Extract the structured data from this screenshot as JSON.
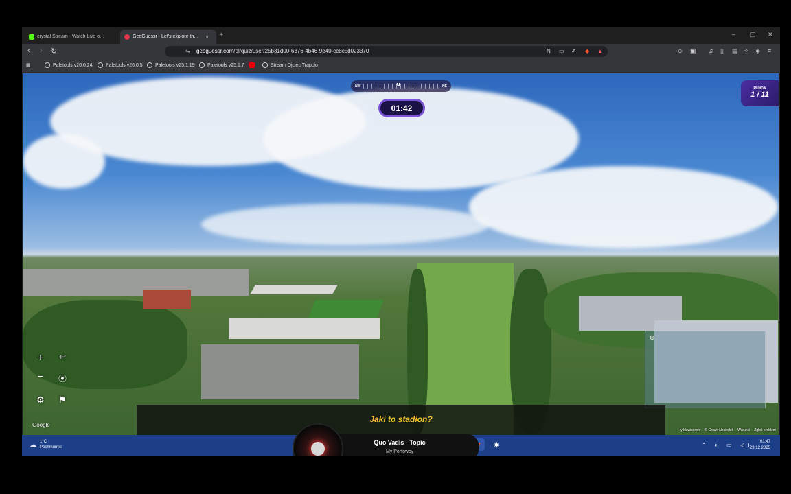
{
  "browser": {
    "tabs": [
      {
        "label": "crystal Stream - Watch Live on Ki",
        "active": false
      },
      {
        "label": "GeoGuessr - Let's explore the wo",
        "active": true
      }
    ],
    "url_host": "geoguessr.com",
    "url_path": "/pl/quiz/user/25b31d00-6376-4b46-9e40-cc8c5d023370",
    "bookmarks": [
      "Paletools v26.0.24",
      "Paletools v26.0.5",
      "Paletools v25.1.19",
      "Paletools v25.1.7",
      "Stream Ojciec Trapcio"
    ]
  },
  "game": {
    "compass_left": "NW",
    "compass_center": "N",
    "compass_right": "NE",
    "timer": "01:42",
    "round_label": "RUNDA",
    "round_value": "1 / 11",
    "question": "Jaki to stadion?",
    "google_logo": "Google",
    "attribution": [
      "ty klawiszowe",
      "© Grawit Nosiedek",
      "Warunki",
      "Zgłoś problem"
    ],
    "controls": {
      "zoom_in": "+",
      "zoom_out": "−",
      "undo": "↩",
      "pin": "⦿",
      "settings": "⚙",
      "flag": "⚑"
    }
  },
  "taskbar": {
    "temperature": "1°C",
    "weather": "Pochmurnie",
    "time": "01:47",
    "date": "29.12.2025"
  },
  "media": {
    "title": "Quo Vadis - Topic",
    "artist": "My Portowcy"
  },
  "colors": {
    "accent": "#7b54d6",
    "caption": "#f2c230",
    "taskbar": "#1d3f87"
  }
}
